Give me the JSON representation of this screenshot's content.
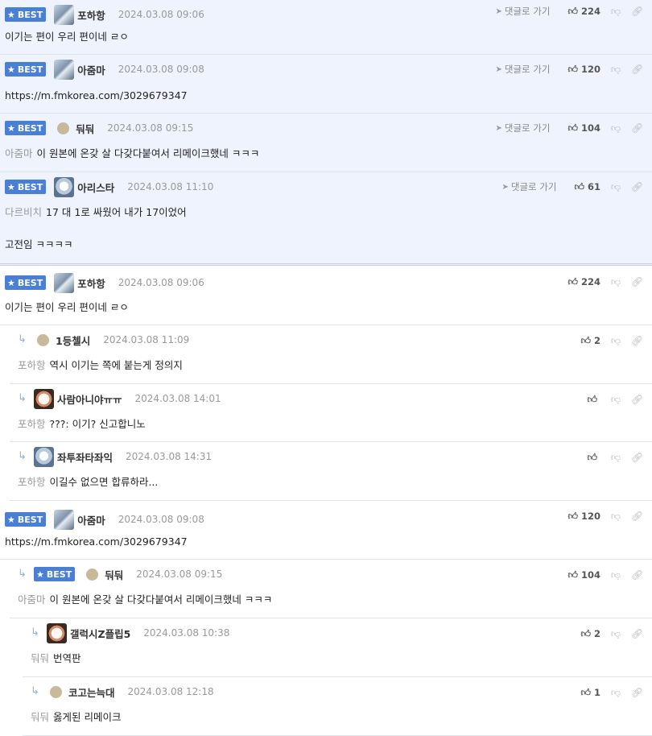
{
  "labels": {
    "best": "BEST",
    "goto": "댓글로 가기"
  },
  "colors": {
    "best_badge": "#4a7fd6",
    "best_bg": "#eef3fd",
    "mention": "#999999"
  },
  "best_comments": [
    {
      "nick": "포하항",
      "date": "2024.03.08 09:06",
      "likes": "224",
      "mention": "",
      "text": "이기는 편이 우리 편이네 ㄹㅇ",
      "text2": ""
    },
    {
      "nick": "아줌마",
      "date": "2024.03.08 09:08",
      "likes": "120",
      "mention": "",
      "text": "https://m.fmkorea.com/3029679347",
      "text2": ""
    },
    {
      "nick": "둬둬",
      "date": "2024.03.08 09:15",
      "likes": "104",
      "mention": "아줌마",
      "text": "이 원본에 온갖 살 다갖다붙여서 리메이크했네 ㅋㅋㅋ",
      "text2": ""
    },
    {
      "nick": "아리스타",
      "date": "2024.03.08 11:10",
      "likes": "61",
      "mention": "다르비치",
      "text": "17 대 1로 싸웠어 내가 17이었어",
      "text2": "고전임 ㅋㅋㅋㅋ"
    }
  ],
  "thread": [
    {
      "nick": "포하항",
      "date": "2024.03.08 09:06",
      "likes": "224",
      "mention": "",
      "text": "이기는 편이 우리 편이네 ㄹㅇ"
    },
    {
      "nick": "1등첼시",
      "date": "2024.03.08 11:09",
      "likes": "2",
      "mention": "포하항",
      "text": "역시 이기는 쪽에 붙는게 정의지"
    },
    {
      "nick": "사람아니야ㅠㅠ",
      "date": "2024.03.08 14:01",
      "likes": "",
      "mention": "포하항",
      "text": "???: 이기? 신고합니노"
    },
    {
      "nick": "좌투좌타좌익",
      "date": "2024.03.08 14:31",
      "likes": "",
      "mention": "포하항",
      "text": "이길수 없으면 합류하라..."
    },
    {
      "nick": "아줌마",
      "date": "2024.03.08 09:08",
      "likes": "120",
      "mention": "",
      "text": "https://m.fmkorea.com/3029679347"
    },
    {
      "nick": "둬둬",
      "date": "2024.03.08 09:15",
      "likes": "104",
      "mention": "아줌마",
      "text": "이 원본에 온갖 살 다갖다붙여서 리메이크했네 ㅋㅋㅋ"
    },
    {
      "nick": "갤럭시Z플립5",
      "date": "2024.03.08 10:38",
      "likes": "2",
      "mention": "둬둬",
      "text": "번역판"
    },
    {
      "nick": "코고는늑대",
      "date": "2024.03.08 12:18",
      "likes": "1",
      "mention": "둬둬",
      "text": "옳게된 리메이크"
    }
  ]
}
